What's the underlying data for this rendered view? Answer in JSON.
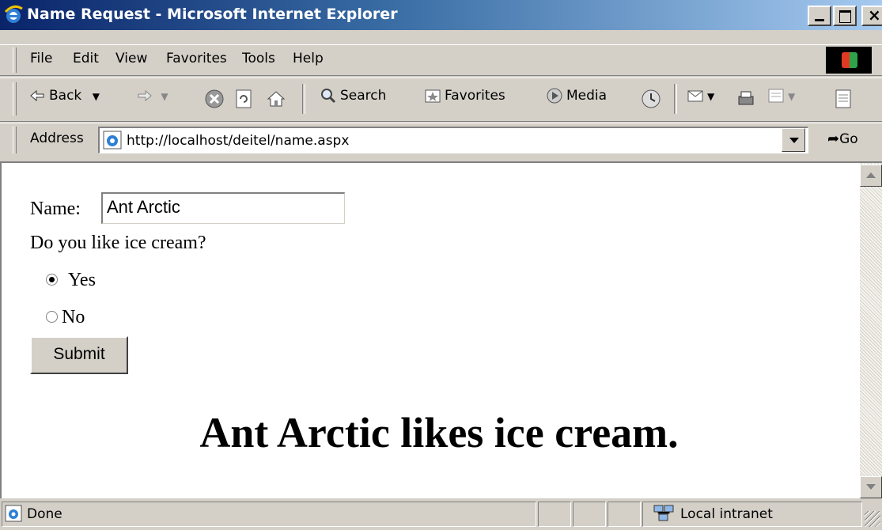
{
  "window": {
    "title": "Name Request - Microsoft Internet Explorer"
  },
  "menu": {
    "items": [
      "File",
      "Edit",
      "View",
      "Favorites",
      "Tools",
      "Help"
    ]
  },
  "toolbar": {
    "back": "Back",
    "search": "Search",
    "favorites": "Favorites",
    "media": "Media"
  },
  "address": {
    "label": "Address",
    "url": "http://localhost/deitel/name.aspx",
    "go": "Go"
  },
  "form": {
    "name_label": "Name:",
    "name_value": "Ant Arctic",
    "question": "Do you like ice cream?",
    "options": [
      {
        "label": "Yes",
        "checked": true
      },
      {
        "label": "No",
        "checked": false
      }
    ],
    "submit_label": "Submit"
  },
  "result": {
    "message": "Ant Arctic likes ice cream."
  },
  "status": {
    "text": "Done",
    "zone": "Local intranet"
  },
  "colors": {
    "titlebar_start": "#0a246a",
    "titlebar_end": "#a6caf0",
    "chrome": "#d4d0c8"
  }
}
